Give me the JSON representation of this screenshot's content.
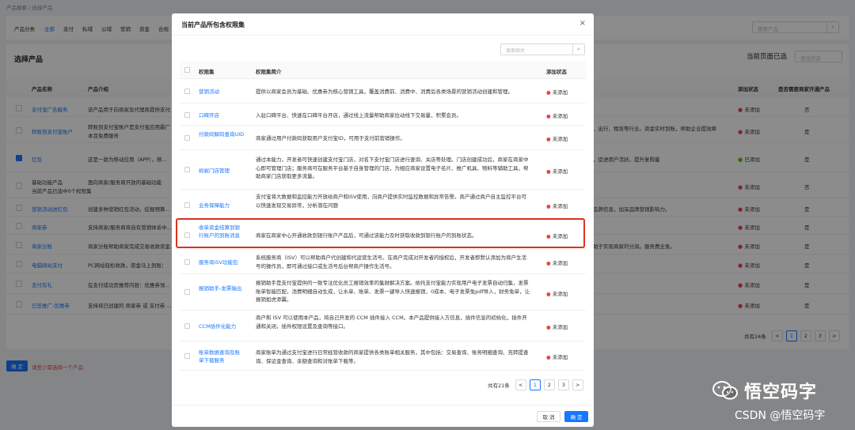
{
  "background": {
    "breadcrumb": "产品搜索 / 选择产品",
    "filter_label": "产品分类",
    "categories": [
      "全部",
      "支付",
      "私域",
      "公域",
      "营销",
      "资金",
      "合规"
    ],
    "search_placeholder": "搜索产品",
    "section_title": "选择产品",
    "right_title": "当前页面已选",
    "status_select": "添加状态",
    "columns": {
      "name": "产品名称",
      "intro": "产品介绍",
      "status": "添加状态",
      "flag": "是否需要商家开通产品"
    },
    "rows": [
      {
        "name": "支付宝广告服务",
        "intro": "该产品用于向商家及代理商提供支付...",
        "tail": "",
        "status": "未添加",
        "flag": "否"
      },
      {
        "name": "转账到支付宝账户",
        "intro": "转账到支付宝账户是支付宝应用最广",
        "intro2": "本且免费服务",
        "tail": "、出行、租赁等行业。资金实时到账，帮助企业提效降",
        "status": "未添加",
        "flag": "是"
      },
      {
        "name": "红包",
        "intro": "这是一款为移动应用（APP），移...",
        "tail": "，促进用户活跃，提升复购量",
        "status": "已添加",
        "flag": "是"
      },
      {
        "name": "基础功能产品",
        "intro": "面向商家/服务商开放的基础功能",
        "intro2": "当前产品已选中0个权限集",
        "tail": "",
        "status": "未添加",
        "flag": "否"
      },
      {
        "name": "营销活动送红包",
        "intro": "创建多种营销红包活动，挖掘预算...",
        "tail": "品牌信息，加深品牌营销影响力。",
        "status": "未添加",
        "flag": "是"
      },
      {
        "name": "商家券",
        "intro": "支持商家/服务商将自有营销体系中...",
        "tail": "",
        "status": "未添加",
        "flag": "是"
      },
      {
        "name": "商家分账",
        "intro": "商家分账帮助商家完成交易收款资金...",
        "tail": "助于实现商家的分润。服务费全免。",
        "status": "未添加",
        "flag": "是"
      },
      {
        "name": "电脑网站支付",
        "intro": "PC网站轻松收款，资金马上到账：",
        "tail": "",
        "status": "未添加",
        "flag": "是"
      },
      {
        "name": "支付有礼",
        "intro": "在支付成功页推荐内容：优惠券领...",
        "tail": "",
        "status": "未添加",
        "flag": "是"
      },
      {
        "name": "已签推广-优惠券",
        "intro": "支持将已创建的 商家券 或 支付券 ...",
        "tail": "",
        "status": "未添加",
        "flag": "是"
      }
    ],
    "pager": {
      "total": "共有24条",
      "prev": "<",
      "pages": [
        "1",
        "2",
        "3"
      ],
      "next": ">"
    },
    "confirm_label": "确 定",
    "warning": "请至少需选择一个产品"
  },
  "modal": {
    "title": "当前产品所包含权限集",
    "close": "×",
    "search_placeholder": "搜索相关",
    "columns": {
      "name": "权限集",
      "desc": "权限集简介",
      "status": "添加状态"
    },
    "rows": [
      {
        "name": "营销活动",
        "desc": "提供以商家会员为基础、优惠券为核心营销工具，覆盖消费前、消费中、消费后各类场景的营销活动创建和管理。",
        "status": "未添加"
      },
      {
        "name": "口碑开店",
        "desc": "入驻口碑平台、快速在口碑平台开店，通过线上流量帮助商家拉动线下交易量，积累会员。",
        "status": "未添加"
      },
      {
        "name": "付款码解码查询UID",
        "desc": "商家通过用户付款码获取用户支付宝ID，可用于支付前营销操作。",
        "status": "未添加"
      },
      {
        "name": "蚂蚁门店管理",
        "desc": "通过本能力，开发者可快速创建支付宝门店，对名下支付宝门店进行查询、关店等处理。门店创建成功后，商家在商家中心即可管理门店；服务商可在服务平台基于自身管理的门店，为相应商家设置电子名片、推广机具、物料等辅助工具，帮助商家门店获取更多流量。",
        "status": "未添加"
      },
      {
        "name": "业务保障能力",
        "desc": "支付宝将大数据和监控能力开放给商户和ISV使用，向商户提供实时监控数据和异常告警。商户通过商户自主监控平台可以快速发现交易异常，分析潜在问题",
        "status": "未添加"
      },
      {
        "name": "收单资金结算到银行账户的到账消息",
        "desc": "商家在商家中心开通收款到银行账户产品后，可通过该能力及时获取收款到银行账户的到账状态。",
        "status": "未添加"
      },
      {
        "name": "服务商ISV功能包",
        "desc": "系统服务商（ISV）可以帮助商户代创建和代运营生活号。在商户完成对开发者的授权后，开发者即默认添加为商户生活号的操作员，即可通过接口或生活号后台帮商户操作生活号。",
        "status": "未添加"
      },
      {
        "name": "报销助手-发票输出",
        "desc": "报销助手是支付宝提供的一致专注优化员工报销效率的集财解决方案。依托支付宝能力实现用户电子发票自动归集，发票账单智能匹配，消费明细自动生成，让水单、账单、发票一键导入快速报销，0成本、电子发票免pdf导入，财务免单，让报销如虎添翼。",
        "status": "未添加"
      },
      {
        "name": "CCM插件化能力",
        "desc": "商户和 ISV 可以使用本产品，将自己开发的 CCM 插件接入 CCM。本产品提供接入方信息，插件信息的初始化，插件开通和关闭，插件权限设置及查询等接口。",
        "status": "未添加"
      },
      {
        "name": "账单数据查询及账单下载服务",
        "desc": "商家账单为通过支付宝进行日常经营收款的商家提供各类账单相关服务，其中包括：交易查询、账务明细查询、充转提查询、保证金查询、余额查询和对账单下载等。",
        "status": "未添加"
      }
    ],
    "pager": {
      "total": "共有21条",
      "prev": "<",
      "pages": [
        "1",
        "2",
        "3"
      ],
      "next": ">"
    },
    "cancel_label": "取 消",
    "ok_label": "确 定"
  },
  "watermark": {
    "brand": "悟空码字",
    "csdn": "CSDN @悟空码字"
  },
  "colors": {
    "accent": "#1677ff",
    "highlight": "#e0301e",
    "status_dot": "#e5484d",
    "added_dot": "#52c41a"
  }
}
